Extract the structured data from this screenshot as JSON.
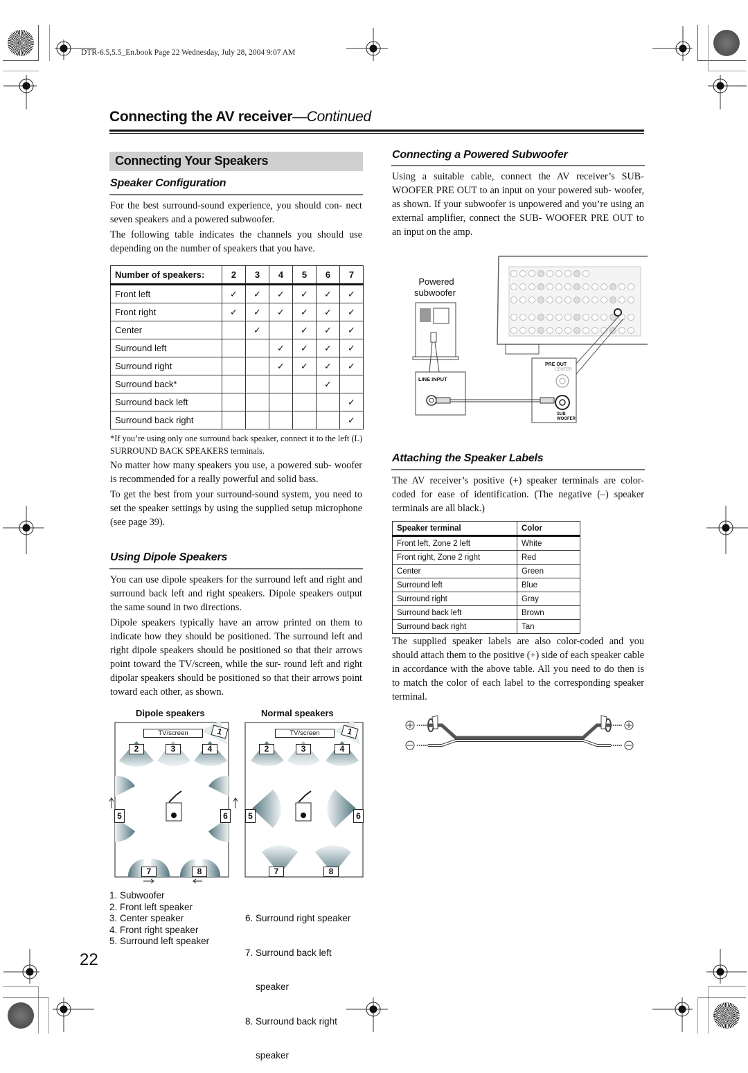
{
  "slug": "DTR-6.5,5.5_En.book  Page 22  Wednesday, July 28, 2004  9:07 AM",
  "page_title": {
    "main": "Connecting the AV receiver",
    "suffix": "—Continued"
  },
  "page_number": "22",
  "left": {
    "section_title": "Connecting Your Speakers",
    "speaker_config": {
      "heading": "Speaker Configuration",
      "paragraphs": [
        "For the best surround-sound experience, you should con- nect seven speakers and a powered subwoofer.",
        "The following table indicates the channels you should use depending on the number of speakers that you have."
      ],
      "table": {
        "header_label": "Number of speakers:",
        "counts": [
          "2",
          "3",
          "4",
          "5",
          "6",
          "7"
        ],
        "check_glyph": "✓",
        "rows": [
          {
            "label": "Front left",
            "checks": [
              true,
              true,
              true,
              true,
              true,
              true
            ]
          },
          {
            "label": "Front right",
            "checks": [
              true,
              true,
              true,
              true,
              true,
              true
            ]
          },
          {
            "label": "Center",
            "checks": [
              false,
              true,
              false,
              true,
              true,
              true
            ]
          },
          {
            "label": "Surround left",
            "checks": [
              false,
              false,
              true,
              true,
              true,
              true
            ]
          },
          {
            "label": "Surround right",
            "checks": [
              false,
              false,
              true,
              true,
              true,
              true
            ]
          },
          {
            "label": "Surround back*",
            "checks": [
              false,
              false,
              false,
              false,
              true,
              false
            ]
          },
          {
            "label": "Surround back left",
            "checks": [
              false,
              false,
              false,
              false,
              false,
              true
            ]
          },
          {
            "label": "Surround back right",
            "checks": [
              false,
              false,
              false,
              false,
              false,
              true
            ]
          }
        ]
      },
      "footnote": "*If you’re using only one surround back speaker, connect it to the left (L) SURROUND BACK SPEAKERS terminals.",
      "after_paragraphs": [
        "No matter how many speakers you use, a powered sub- woofer is recommended for a really powerful and solid bass.",
        "To get the best from your surround-sound system, you need to set the speaker settings by using the supplied setup microphone (see page 39)."
      ]
    },
    "dipole": {
      "heading": "Using Dipole Speakers",
      "paragraphs": [
        "You can use dipole speakers for the surround left and right and surround back left and right speakers. Dipole speakers output the same sound in two directions.",
        "Dipole speakers typically have an arrow printed on them to indicate how they should be positioned. The surround left and right dipole speakers should be positioned so that their arrows point toward the TV/screen, while the sur- round left and right dipolar speakers should be positioned so that their arrows point toward each other, as shown."
      ],
      "diagram_titles": [
        "Dipole speakers",
        "Normal speakers"
      ],
      "tv_label": "TV/screen",
      "speaker_numbers": [
        "1",
        "2",
        "3",
        "4",
        "5",
        "6",
        "7",
        "8"
      ],
      "legend_left": [
        "1. Subwoofer",
        "2. Front left speaker",
        "3. Center speaker",
        "4. Front right speaker",
        "5. Surround left speaker"
      ],
      "legend_right": [
        "6. Surround right speaker",
        "7. Surround back left",
        "    speaker",
        "8. Surround back right",
        "    speaker"
      ]
    }
  },
  "right": {
    "subwoofer": {
      "heading": "Connecting a Powered Subwoofer",
      "paragraph": "Using a suitable cable, connect the AV receiver’s SUB- WOOFER PRE OUT to an input on your powered sub- woofer, as shown. If your subwoofer is unpowered and you’re using an external amplifier, connect the SUB- WOOFER PRE OUT to an input on the amp.",
      "figure": {
        "sub_label_1": "Powered",
        "sub_label_2": "subwoofer",
        "line_input": "LINE INPUT",
        "pre_out": "PRE OUT",
        "center": "CENTER",
        "sub_woofer_1": "SUB",
        "sub_woofer_2": "WOOFER"
      }
    },
    "labels": {
      "heading": "Attaching the Speaker Labels",
      "paragraph": "The AV receiver’s positive (+) speaker terminals are color-coded for ease of identification. (The negative (–) speaker terminals are all black.)",
      "table": {
        "headers": [
          "Speaker terminal",
          "Color"
        ],
        "rows": [
          [
            "Front left, Zone 2 left",
            "White"
          ],
          [
            "Front right, Zone 2 right",
            "Red"
          ],
          [
            "Center",
            "Green"
          ],
          [
            "Surround left",
            "Blue"
          ],
          [
            "Surround right",
            "Gray"
          ],
          [
            "Surround back left",
            "Brown"
          ],
          [
            "Surround back right",
            "Tan"
          ]
        ]
      },
      "after_paragraph": "The supplied speaker labels are also color-coded and you should attach them to the positive (+) side of each speaker cable in accordance with the above table. All you need to do then is to match the color of each label to the corresponding speaker terminal.",
      "plus_symbol": "+",
      "minus_symbol": "−"
    }
  }
}
